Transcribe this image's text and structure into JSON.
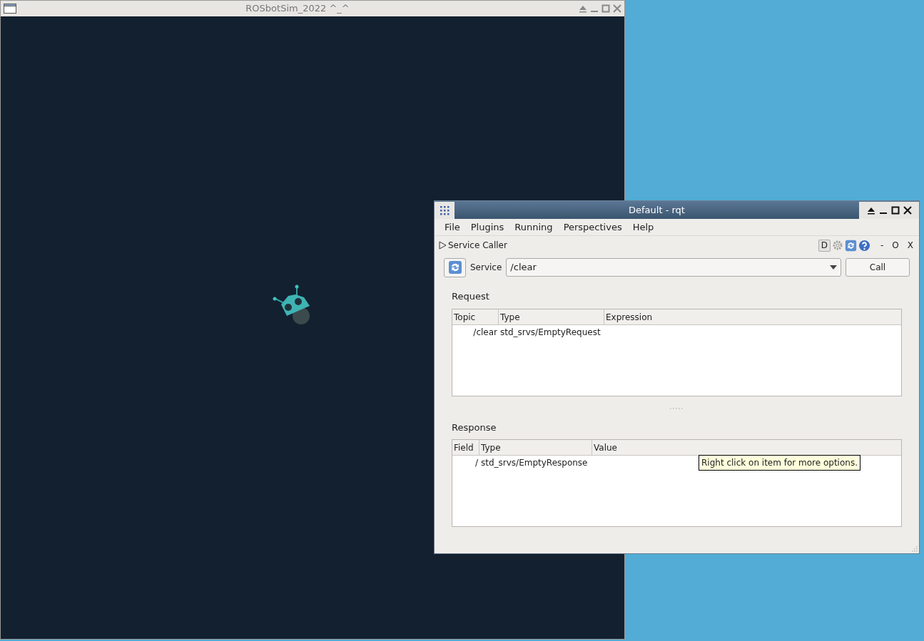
{
  "sim_window": {
    "title": "ROSbotSim_2022 ^_^"
  },
  "rqt_window": {
    "title": "Default - rqt",
    "menu": [
      "File",
      "Plugins",
      "Running",
      "Perspectives",
      "Help"
    ],
    "plugin": {
      "title": "Service Caller",
      "expanded": false,
      "d_button": "D",
      "controls": [
        "-",
        "O",
        "X"
      ]
    },
    "service": {
      "label": "Service",
      "value": "/clear",
      "button": "Call"
    },
    "request": {
      "heading": "Request",
      "columns": [
        "Topic",
        "Type",
        "Expression"
      ],
      "rows": [
        [
          "/clear",
          "std_srvs/EmptyRequest"
        ]
      ]
    },
    "response": {
      "heading": "Response",
      "columns": [
        "Field",
        "Type",
        "Value"
      ],
      "rows": [
        [
          "/",
          "std_srvs/EmptyResponse"
        ]
      ]
    },
    "tooltip": "Right click on item for more options."
  }
}
